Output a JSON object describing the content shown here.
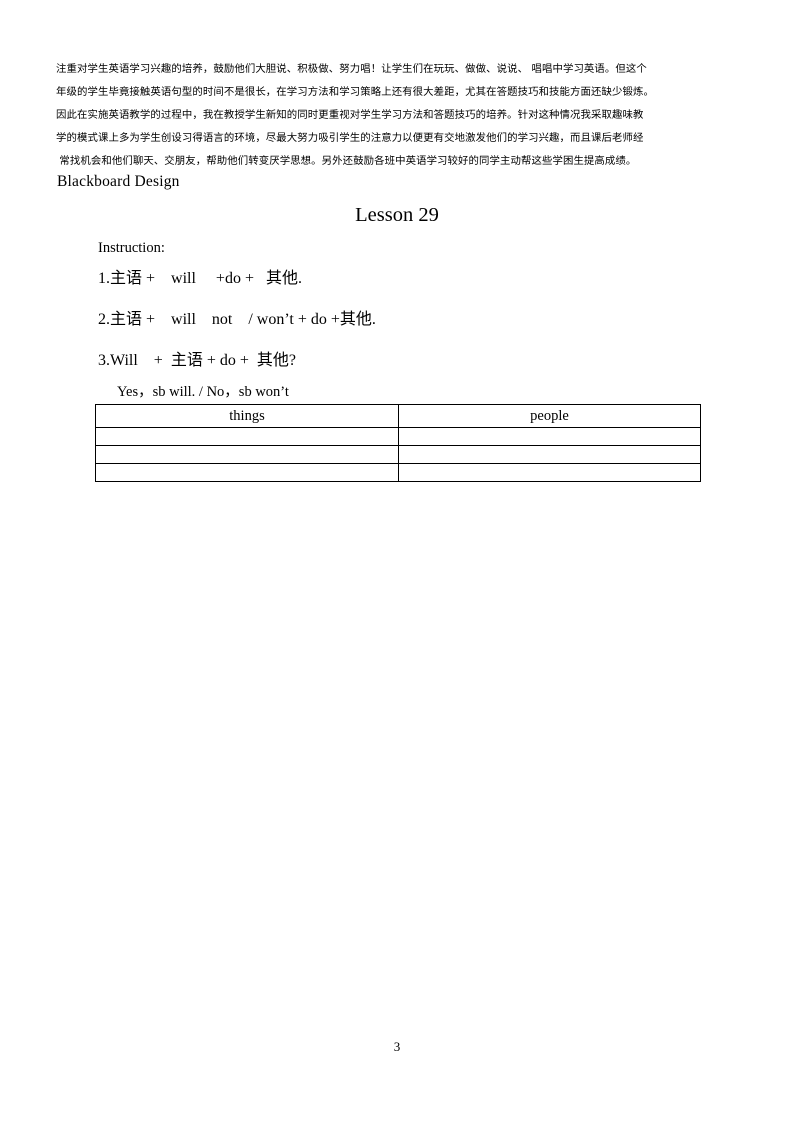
{
  "document": {
    "paragraph": {
      "lines": [
        "注重对学生英语学习兴趣的培养，鼓励他们大胆说、积极做、努力唱！让学生们在玩玩、做做、说说、 唱唱中学习英语。但这个",
        "年级的学生毕竟接触英语句型的时间不是很长，在学习方法和学习策略上还有很大差距，尤其在答题技巧和技能方面还缺少锻炼。",
        "因此在实施英语教学的过程中，我在教授学生新知的同时更重视对学生学习方法和答题技巧的培养。针对这种情况我采取趣味教",
        "学的模式课上多为学生创设习得语言的环境，尽最大努力吸引学生的注意力以便更有交地激发他们的学习兴趣，而且课后老师经",
        " 常找机会和他们聊天、交朋友，帮助他们转变厌学思想。另外还鼓励各班中英语学习较好的同学主动帮这些学困生提高成绩。"
      ]
    },
    "blackboard_design_heading": "Blackboard Design",
    "lesson_title": "Lesson 29",
    "instruction_label": "Instruction:",
    "formulas": [
      "1.主语 +    will     +do +   其他.",
      "2.主语 +    will    not    / won’t + do +其他.",
      "3.Will    +  主语 + do +  其他?"
    ],
    "answer_line": "Yes，sb will. / No，sb won’t",
    "table": {
      "headers": [
        "things",
        "people"
      ],
      "empty_rows": 3
    },
    "page_number": "3"
  }
}
